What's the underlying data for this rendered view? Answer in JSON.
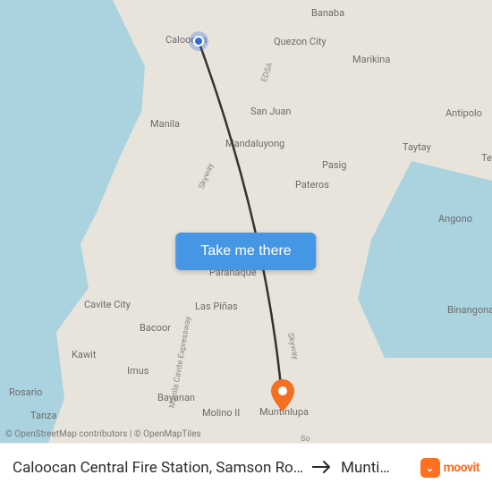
{
  "map": {
    "places": {
      "caloocan": "Caloocan",
      "quezon": "Quezon City",
      "marikina": "Marikina",
      "banaba": "Banaba",
      "sanjuan": "San Juan",
      "manila": "Manila",
      "mandaluyong": "Mandaluyong",
      "pasig": "Pasig",
      "pateros": "Pateros",
      "taytay": "Taytay",
      "antipolo": "Antipolo",
      "te": "Te",
      "angono": "Angono",
      "paranaque": "Parañaque",
      "laspinas": "Las Piñas",
      "cavitecity": "Cavite City",
      "bacoor": "Bacoor",
      "kawit": "Kawit",
      "imus": "Imus",
      "rosario": "Rosario",
      "tanza": "Tanza",
      "bayanan": "Bayanan",
      "molino": "Molino II",
      "muntinlupa": "Muntinlupa",
      "binangonan": "Binangonan"
    },
    "roads": {
      "edsa": "EDSA",
      "skyway1": "Skyway",
      "skyway2": "Skyway",
      "manilacavite": "Manila Cavite Expressway",
      "so": "So"
    },
    "cta_label": "Take me there",
    "attribution": "© OpenStreetMap contributors | © OpenMapTiles",
    "colors": {
      "water": "#aad3df",
      "land": "#e8e4dc",
      "route": "#333333",
      "start_marker": "#2f6bd8",
      "end_marker": "#f36f21",
      "cta": "#4596e4"
    }
  },
  "footer": {
    "origin": "Caloocan Central Fire Station, Samson Ro…",
    "destination": "Munti…",
    "brand": "moovit"
  }
}
